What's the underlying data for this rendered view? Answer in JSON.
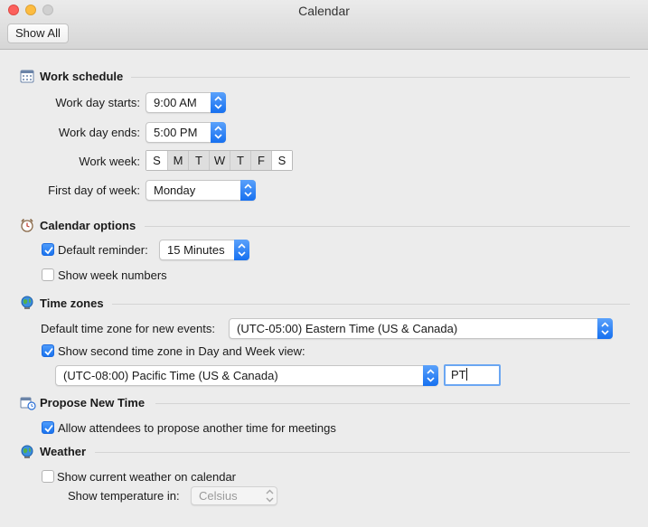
{
  "window": {
    "title": "Calendar"
  },
  "toolbar": {
    "show_all": "Show All"
  },
  "work_schedule": {
    "title": "Work schedule",
    "start_label": "Work day starts:",
    "start_value": "9:00 AM",
    "end_label": "Work day ends:",
    "end_value": "5:00 PM",
    "week_label": "Work week:",
    "days": [
      {
        "label": "S",
        "selected": false
      },
      {
        "label": "M",
        "selected": true
      },
      {
        "label": "T",
        "selected": true
      },
      {
        "label": "W",
        "selected": true
      },
      {
        "label": "T",
        "selected": true
      },
      {
        "label": "F",
        "selected": true
      },
      {
        "label": "S",
        "selected": false
      }
    ],
    "first_day_label": "First day of week:",
    "first_day_value": "Monday"
  },
  "calendar_options": {
    "title": "Calendar options",
    "default_reminder_label": "Default reminder:",
    "default_reminder_checked": true,
    "default_reminder_value": "15 Minutes",
    "show_week_numbers_label": "Show week numbers",
    "show_week_numbers_checked": false
  },
  "time_zones": {
    "title": "Time zones",
    "default_tz_label": "Default time zone for new events:",
    "default_tz_value": "(UTC-05:00) Eastern Time (US & Canada)",
    "second_tz_label": "Show second time zone in Day and Week view:",
    "second_tz_checked": true,
    "second_tz_value": "(UTC-08:00) Pacific Time (US & Canada)",
    "second_tz_abbrev": "PT"
  },
  "propose_new_time": {
    "title": "Propose New Time",
    "allow_label": "Allow attendees to propose another time for meetings",
    "allow_checked": true
  },
  "weather": {
    "title": "Weather",
    "show_weather_label": "Show current weather on calendar",
    "show_weather_checked": false,
    "temp_label": "Show temperature in:",
    "temp_value": "Celsius"
  },
  "colors": {
    "accent": "#1670f0",
    "background": "#ececec"
  }
}
